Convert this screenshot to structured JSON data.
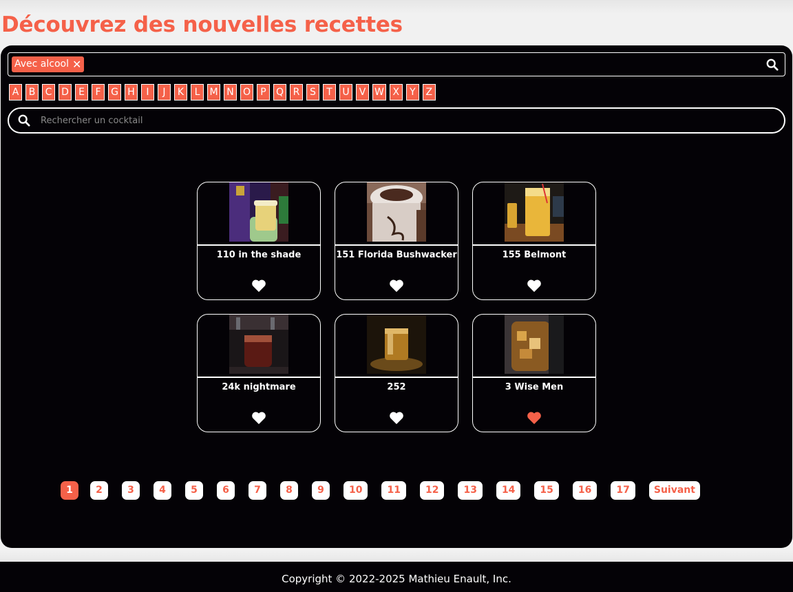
{
  "page_title": "Découvrez des nouvelles recettes",
  "colors": {
    "accent": "#f56149",
    "panel_bg": "#040206",
    "text": "#ffffff"
  },
  "filter": {
    "active_tag": "Avec alcool",
    "tag_close_icon": "close-icon",
    "search_icon": "search-icon"
  },
  "alphabet": [
    "A",
    "B",
    "C",
    "D",
    "E",
    "F",
    "G",
    "H",
    "I",
    "J",
    "K",
    "L",
    "M",
    "N",
    "O",
    "P",
    "Q",
    "R",
    "S",
    "T",
    "U",
    "V",
    "W",
    "X",
    "Y",
    "Z"
  ],
  "search": {
    "placeholder": "Rechercher un cocktail",
    "value": ""
  },
  "cocktails": [
    {
      "name": "110 in the shade",
      "favorite": false
    },
    {
      "name": "151 Florida Bushwacker",
      "favorite": false
    },
    {
      "name": "155 Belmont",
      "favorite": false
    },
    {
      "name": "24k nightmare",
      "favorite": false
    },
    {
      "name": "252",
      "favorite": false
    },
    {
      "name": "3 Wise Men",
      "favorite": true
    }
  ],
  "pagination": {
    "current": "1",
    "pages": [
      "1",
      "2",
      "3",
      "4",
      "5",
      "6",
      "7",
      "8",
      "9",
      "10",
      "11",
      "12",
      "13",
      "14",
      "15",
      "16",
      "17"
    ],
    "next_label": "Suivant"
  },
  "footer": {
    "copyright": "Copyright © 2022-2025 Mathieu Enault, Inc."
  }
}
